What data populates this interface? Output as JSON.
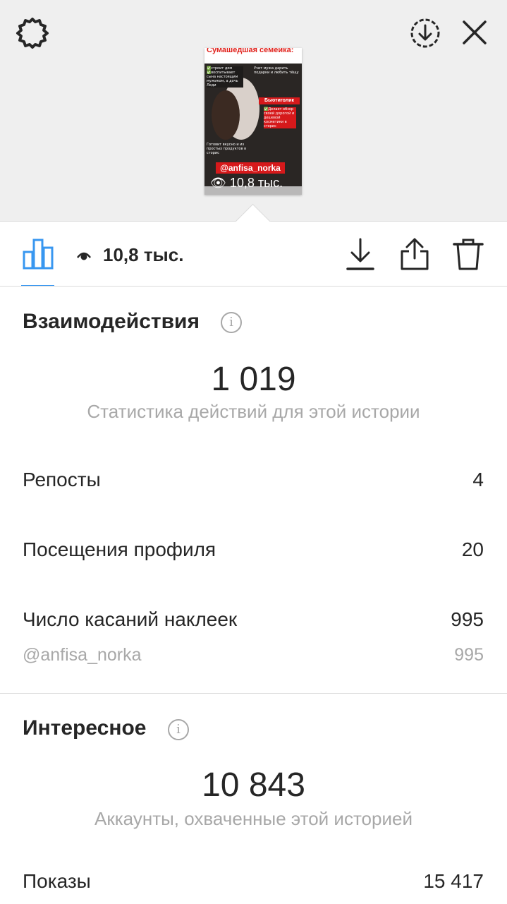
{
  "story_preview": {
    "title": "Сумашедшая семейка:",
    "text_left": "✅строит дом ✅воспитывает сына настоящим мужиком, а дочь Леди",
    "text_right": "Учит мужа дарить подарки и любить тёщу",
    "badge_beauty": "Бьютиголик",
    "text_beauty": "✅Делает обзор своей дорогой и дешевой косметики в сторис",
    "text_bottom_left": "Готовит вкусно и из простых продуктов в сторис",
    "username_badge": "@anfisa_norka",
    "views_overlay": "10,8 тыс."
  },
  "toolbar": {
    "views": "10,8 тыс."
  },
  "interactions": {
    "title": "Взаимодействия",
    "total": "1 019",
    "caption": "Статистика действий для этой истории",
    "rows": [
      {
        "label": "Репосты",
        "value": "4"
      },
      {
        "label": "Посещения профиля",
        "value": "20"
      },
      {
        "label": "Число касаний наклеек",
        "value": "995"
      }
    ],
    "sub_row": {
      "label": "@anfisa_norka",
      "value": "995"
    }
  },
  "discovery": {
    "title": "Интересное",
    "total": "10 843",
    "caption": "Аккаунты, охваченные этой историей",
    "rows": [
      {
        "label": "Показы",
        "value": "15 417"
      }
    ]
  },
  "colors": {
    "accent": "#3897f0",
    "text": "#262626",
    "muted": "#a8a8a8",
    "top_background": "#efefef",
    "divider": "#dbdbdb",
    "story_red": "#d6191b"
  },
  "icons": {
    "settings": "gear-icon",
    "save_story": "download-circle-icon",
    "close": "close-icon",
    "insights": "bar-chart-icon",
    "views": "eye-icon",
    "download": "download-icon",
    "share": "share-icon",
    "delete": "trash-icon",
    "info": "info-icon"
  }
}
